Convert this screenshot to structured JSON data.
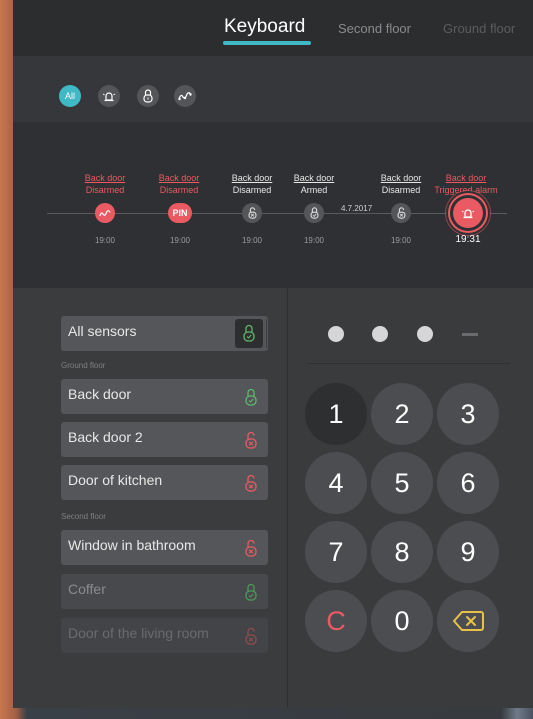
{
  "tabs": {
    "active": "Keyboard",
    "second": "Second floor",
    "third": "Ground floor"
  },
  "filters": {
    "all_label": "All",
    "icons": [
      "all-icon",
      "siren-icon",
      "lock-icon",
      "motion-icon"
    ]
  },
  "timeline": {
    "date": "4.7.2017",
    "events": [
      {
        "line1": "Back door",
        "line2": "Disarmed",
        "time": "19:00",
        "color": "#ea5a62",
        "icon": "motion-icon"
      },
      {
        "line1": "Back door",
        "line2": "Disarmed",
        "time": "19:00",
        "color": "#ea5a62",
        "icon": "pin-badge",
        "pin": "PIN"
      },
      {
        "line1": "Back door",
        "line2": "Disarmed",
        "time": "19:00",
        "color": "#e6e6e6",
        "icon": "lock-open-icon"
      },
      {
        "line1": "Back door",
        "line2": "Armed",
        "time": "19:00",
        "color": "#e6e6e6",
        "icon": "lock-closed-icon"
      },
      {
        "line1": "Back door",
        "line2": "Disarmed",
        "time": "19:00",
        "color": "#e6e6e6",
        "icon": "lock-open-icon"
      },
      {
        "line1": "Back door",
        "line2": "Triggered alarm",
        "time": "19:31",
        "color": "#ea5a62",
        "icon": "siren-icon"
      }
    ]
  },
  "sensors": {
    "all_label": "All sensors",
    "ground_floor_label": "Ground floor",
    "second_floor_label": "Second floor",
    "items": [
      {
        "name": "Back door",
        "state": "armed"
      },
      {
        "name": "Back door 2",
        "state": "disarmed"
      },
      {
        "name": "Door of kitchen",
        "state": "disarmed"
      },
      {
        "name": "Window in bathroom",
        "state": "disarmed"
      },
      {
        "name": "Coffer",
        "state": "armed"
      },
      {
        "name": "Door of the living room",
        "state": "disarmed"
      }
    ]
  },
  "keypad": {
    "pin_entered": 3,
    "pin_length": 4,
    "keys": [
      "1",
      "2",
      "3",
      "4",
      "5",
      "6",
      "7",
      "8",
      "9",
      "C",
      "0"
    ],
    "backspace_icon": "backspace-icon"
  },
  "colors": {
    "accent": "#41b8c6",
    "alarm": "#ea5a62",
    "armed": "#5fb86a"
  }
}
